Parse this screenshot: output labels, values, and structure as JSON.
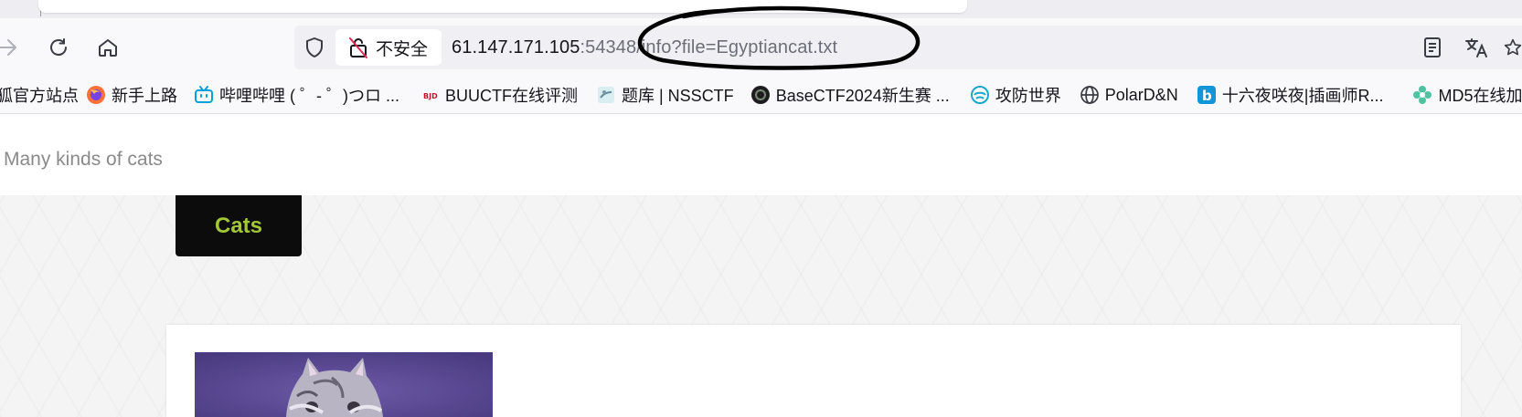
{
  "browser": {
    "nav": {
      "forward_icon": "arrow-right-icon",
      "reload_icon": "reload-icon",
      "home_icon": "home-icon"
    },
    "urlbar": {
      "security_label": "不安全",
      "url_host": "61.147.171.105",
      "url_rest": ":54348/info?file=Egyptiancat.txt"
    }
  },
  "bookmarks": [
    {
      "label": "狐官方站点",
      "icon": "firefox-icon"
    },
    {
      "label": "新手上路",
      "icon": "firefox-icon"
    },
    {
      "label": "哔哩哔哩 ( ゜- ゜)つロ ...",
      "icon": "bilibili-icon"
    },
    {
      "label": "BUUCTF在线评测",
      "icon": "buuctf-icon"
    },
    {
      "label": "题库 | NSSCTF",
      "icon": "nssctf-icon"
    },
    {
      "label": "BaseCTF2024新生赛 ...",
      "icon": "basectf-icon"
    },
    {
      "label": "攻防世界",
      "icon": "adworld-icon"
    },
    {
      "label": "PolarD&N",
      "icon": "globe-icon"
    },
    {
      "label": "十六夜咲夜|插画师R...",
      "icon": "b-icon"
    },
    {
      "label": "MD5在线加",
      "icon": "flower-icon"
    }
  ],
  "page": {
    "site_title": "Many kinds of cats",
    "nav_tab": "Cats"
  },
  "colors": {
    "nav_tab_bg": "#0c0c0c",
    "nav_tab_text": "#a4c639",
    "annotation_stroke": "#000000"
  }
}
